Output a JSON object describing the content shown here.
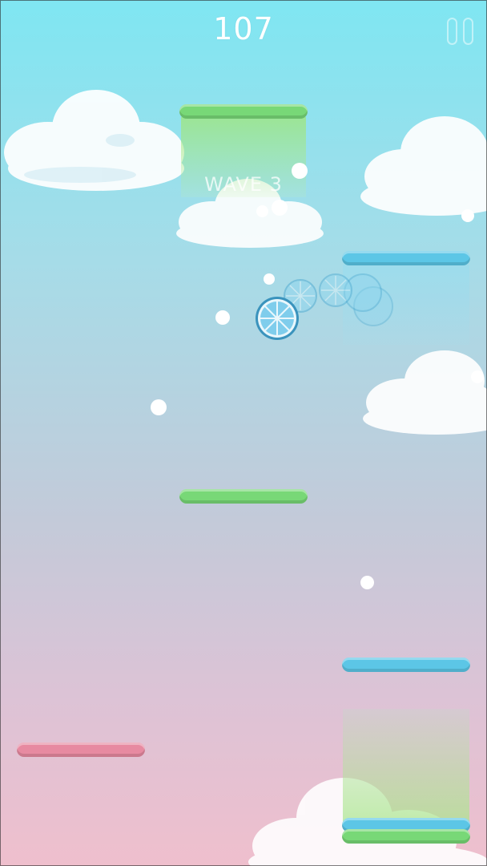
{
  "hud": {
    "score": "107",
    "pause_icon": "pause-icon"
  },
  "wave": {
    "label": "WAVE 3"
  },
  "colors": {
    "green_platform": "#78d877",
    "blue_platform": "#5cc6e6",
    "pink_platform": "#e78aa1",
    "sky_top": "#7fe6f2",
    "sky_bottom": "#efbfcd"
  },
  "player": {
    "icon": "lemon-slice-icon"
  }
}
